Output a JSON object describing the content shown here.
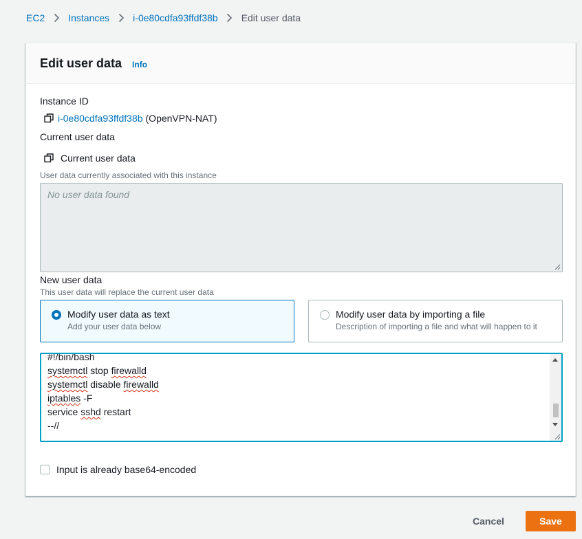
{
  "breadcrumb": {
    "items": [
      "EC2",
      "Instances",
      "i-0e80cdfa93ffdf38b"
    ],
    "current": "Edit user data"
  },
  "page": {
    "title": "Edit user data",
    "info_link": "Info"
  },
  "instance": {
    "label": "Instance ID",
    "id": "i-0e80cdfa93ffdf38b",
    "name": "(OpenVPN-NAT)"
  },
  "current_user_data": {
    "label": "Current user data",
    "copy_label": "Current user data",
    "description": "User data currently associated with this instance",
    "placeholder": "No user data found"
  },
  "new_user_data": {
    "label": "New user data",
    "description": "This user data will replace the current user data",
    "options": [
      {
        "title": "Modify user data as text",
        "description": "Add your user data below",
        "selected": true
      },
      {
        "title": "Modify user data by importing a file",
        "description": "Description of importing a file and what will happen to it",
        "selected": false
      }
    ],
    "script_lines": [
      "#!/bin/bash",
      "systemctl stop firewalld",
      "systemctl disable firewalld",
      "iptables -F",
      "service sshd restart",
      "--//"
    ]
  },
  "base64": {
    "label": "Input is already base64-encoded",
    "checked": false
  },
  "actions": {
    "cancel": "Cancel",
    "save": "Save"
  },
  "colors": {
    "link": "#0073bb",
    "primary_button": "#ec7211",
    "focus_border": "#00a1c9"
  }
}
